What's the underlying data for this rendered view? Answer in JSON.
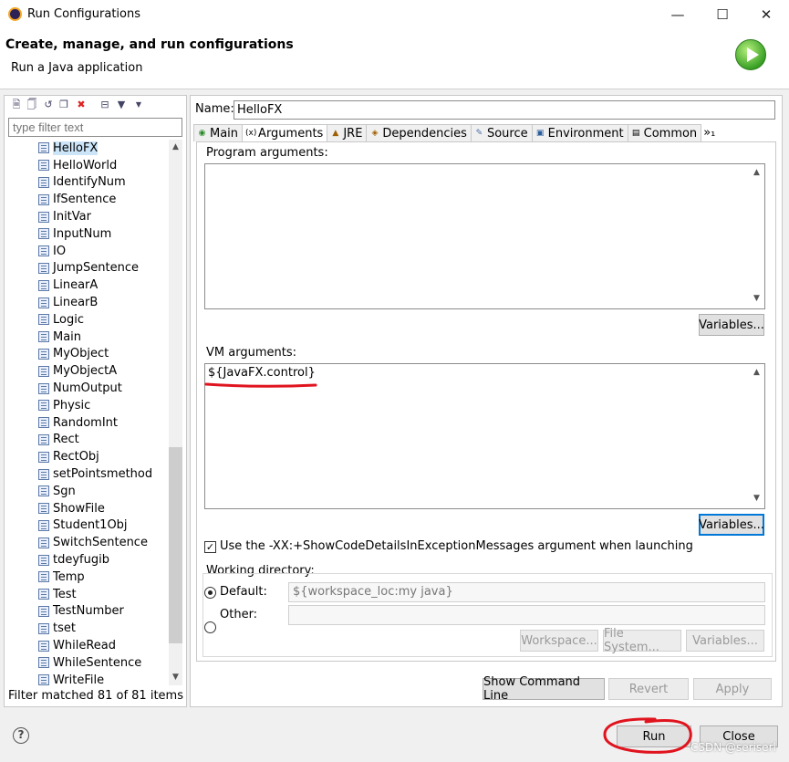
{
  "window": {
    "title": "Run Configurations"
  },
  "header": {
    "title": "Create, manage, and run configurations",
    "subtitle": "Run a Java application"
  },
  "left": {
    "filter_placeholder": "type filter text",
    "items": [
      "HelloFX",
      "HelloWorld",
      "IdentifyNum",
      "IfSentence",
      "InitVar",
      "InputNum",
      "IO",
      "JumpSentence",
      "LinearA",
      "LinearB",
      "Logic",
      "Main",
      "MyObject",
      "MyObjectA",
      "NumOutput",
      "Physic",
      "RandomInt",
      "Rect",
      "RectObj",
      "setPointsmethod",
      "Sgn",
      "ShowFile",
      "Student1Obj",
      "SwitchSentence",
      "tdeyfugib",
      "Temp",
      "Test",
      "TestNumber",
      "tset",
      "WhileRead",
      "WhileSentence",
      "WriteFile"
    ],
    "selected_index": 0,
    "status": "Filter matched 81 of 81 items"
  },
  "config": {
    "name_label": "Name:",
    "name_value": "HelloFX",
    "tabs": [
      "Main",
      "Arguments",
      "JRE",
      "Dependencies",
      "Source",
      "Environment",
      "Common",
      "»₁"
    ],
    "active_tab": 1,
    "program_args_label": "Program arguments:",
    "program_args_value": "",
    "variables_label": "Variables...",
    "vm_args_label": "VM arguments:",
    "vm_args_value": "${JavaFX.control}",
    "checkbox_label": "Use the -XX:+ShowCodeDetailsInExceptionMessages argument when launching",
    "checkbox_checked": true,
    "workdir_label": "Working directory:",
    "default_label": "Default:",
    "default_value": "${workspace_loc:my java}",
    "other_label": "Other:",
    "other_value": "",
    "workspace_btn": "Workspace...",
    "filesystem_btn": "File System...",
    "show_cmd_btn": "Show Command Line",
    "revert_btn": "Revert",
    "apply_btn": "Apply"
  },
  "footer": {
    "run_btn": "Run",
    "close_btn": "Close",
    "help": "?"
  },
  "watermark": "CSDN @seriserl",
  "colors": {
    "annotation": "#e0141e",
    "selection": "#cce4f7",
    "focus": "#0078d7"
  }
}
